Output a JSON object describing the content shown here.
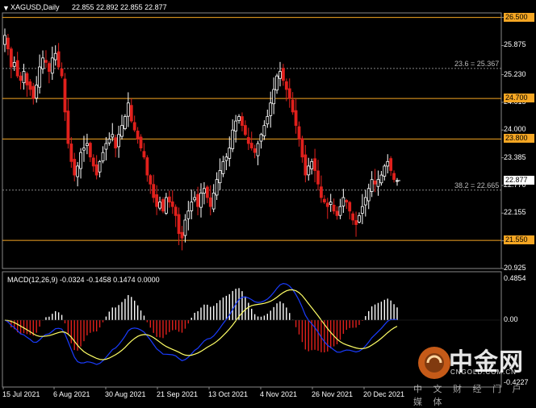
{
  "header": {
    "symbol": "XAGUSD,Daily",
    "ohlc": "22.855 22.892 22.855 22.877",
    "collapse_icon": "triangle-down-icon"
  },
  "price_axis": {
    "labels": [
      "26.500",
      "25.875",
      "25.230",
      "24.615",
      "24.000",
      "23.385",
      "22.770",
      "22.155",
      "21.540",
      "20.925"
    ],
    "current_price": "22.877",
    "current_color": "#ffffff"
  },
  "levels": [
    {
      "label": "26.500",
      "value": 26.5,
      "color": "#f5a623"
    },
    {
      "label": "24.700",
      "value": 24.7,
      "color": "#f5a623"
    },
    {
      "label": "23.800",
      "value": 23.8,
      "color": "#f5a623"
    },
    {
      "label": "21.550",
      "value": 21.55,
      "color": "#f5a623"
    }
  ],
  "fib_levels": [
    {
      "label": "23.6 = 25.367",
      "value": 25.367
    },
    {
      "label": "38.2 = 22.665",
      "value": 22.665
    }
  ],
  "macd": {
    "title": "MACD(12,26,9) -0.0324 -0.1458 0.1474 0.0000",
    "axis_labels": [
      "0.4854",
      "0.00",
      "-0.4227"
    ],
    "hist_pos_color": "#ffffff",
    "hist_neg_color": "#e0201c",
    "main_color": "#1a3cff",
    "signal_color": "#ffff66"
  },
  "time_axis": [
    "15 Jul 2021",
    "6 Aug 2021",
    "30 Aug 2021",
    "21 Sep 2021",
    "13 Oct 2021",
    "4 Nov 2021",
    "26 Nov 2021",
    "20 Dec 2021"
  ],
  "colors": {
    "up": "#ffffff",
    "down": "#e0201c",
    "grid": "#555555"
  },
  "watermark": {
    "name": "中金网",
    "url": "CNGOLD.COM.CN",
    "slogan": "中 文 财 经 门 户 媒 体",
    "logo": "cngold-coin-logo-icon"
  },
  "chart_data": {
    "type": "candlestick",
    "title": "XAGUSD,Daily",
    "ylim": [
      20.925,
      26.6
    ],
    "x_start": "15 Jul 2021",
    "x_end": "20 Dec 2021",
    "close_series": [
      26.1,
      25.8,
      25.4,
      25.5,
      25.2,
      25.1,
      25.3,
      25.0,
      24.9,
      24.7,
      25.0,
      25.4,
      25.6,
      25.5,
      25.3,
      25.6,
      25.7,
      25.4,
      25.2,
      24.4,
      23.7,
      23.3,
      23.0,
      23.2,
      23.5,
      23.6,
      23.7,
      23.4,
      23.2,
      23.0,
      23.3,
      23.5,
      23.7,
      23.8,
      23.9,
      23.6,
      23.9,
      24.1,
      24.3,
      24.6,
      24.2,
      24.0,
      23.8,
      23.6,
      23.4,
      23.0,
      22.8,
      22.5,
      22.3,
      22.4,
      22.2,
      22.5,
      22.4,
      22.3,
      22.1,
      21.7,
      21.6,
      22.0,
      22.2,
      22.4,
      22.5,
      22.3,
      22.6,
      22.7,
      22.5,
      22.3,
      22.6,
      22.9,
      23.1,
      23.3,
      23.4,
      23.6,
      24.0,
      24.2,
      24.3,
      24.1,
      23.9,
      23.7,
      23.6,
      23.5,
      23.7,
      23.9,
      24.1,
      24.3,
      24.6,
      24.9,
      25.2,
      25.3,
      25.1,
      24.9,
      24.7,
      24.4,
      24.1,
      23.8,
      23.4,
      23.0,
      23.2,
      23.3,
      23.1,
      22.8,
      22.5,
      22.4,
      22.3,
      22.4,
      22.2,
      22.1,
      22.3,
      22.5,
      22.4,
      22.2,
      22.0,
      21.9,
      22.1,
      22.3,
      22.5,
      22.7,
      22.9,
      22.8,
      22.9,
      23.0,
      23.2,
      23.3,
      23.1,
      22.9,
      22.877
    ]
  }
}
